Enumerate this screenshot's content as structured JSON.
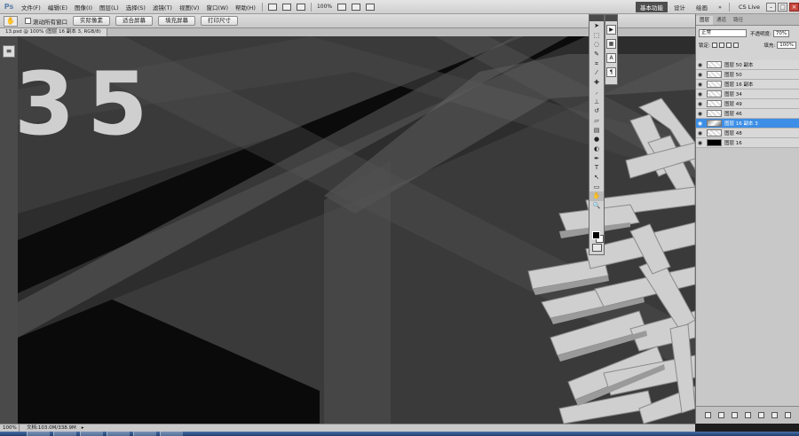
{
  "app": {
    "logo": "Ps"
  },
  "menu": {
    "items": [
      "文件(F)",
      "编辑(E)",
      "图像(I)",
      "图层(L)",
      "选择(S)",
      "滤镜(T)",
      "视图(V)",
      "窗口(W)",
      "帮助(H)"
    ],
    "zoom": "100%",
    "workspaces": [
      "基本功能",
      "设计",
      "绘画"
    ],
    "cs_live": "CS Live",
    "more": "»"
  },
  "options": {
    "scroll_all_windows": "滚动所有窗口",
    "buttons": [
      "实际像素",
      "适合屏幕",
      "填充屏幕",
      "打印尺寸"
    ]
  },
  "document": {
    "tab_title": "13.psd @ 100% (图层 16 副本 3, RGB/8)",
    "big_text": "35"
  },
  "layers_panel": {
    "tabs": [
      "图层",
      "通道",
      "路径"
    ],
    "blend_mode": "正常",
    "opacity_label": "不透明度:",
    "opacity_value": "70%",
    "lock_label": "锁定:",
    "fill_label": "填充:",
    "fill_value": "100%",
    "layers": [
      {
        "name": "图层 50 副本",
        "thumb": "checker",
        "selected": false
      },
      {
        "name": "图层 50",
        "thumb": "checker",
        "selected": false
      },
      {
        "name": "图层 16 副本",
        "thumb": "checker",
        "selected": false
      },
      {
        "name": "图层 34",
        "thumb": "checker",
        "selected": false
      },
      {
        "name": "图层 49",
        "thumb": "checker",
        "selected": false
      },
      {
        "name": "图层 46",
        "thumb": "checker",
        "selected": false
      },
      {
        "name": "图层 16 副本 3",
        "thumb": "img",
        "selected": true
      },
      {
        "name": "图层 48",
        "thumb": "checker",
        "selected": false
      },
      {
        "name": "图层 16",
        "thumb": "black",
        "selected": false
      }
    ]
  },
  "statusbar": {
    "zoom": "100%",
    "doc_info": "文档:103.0M/338.9M"
  }
}
